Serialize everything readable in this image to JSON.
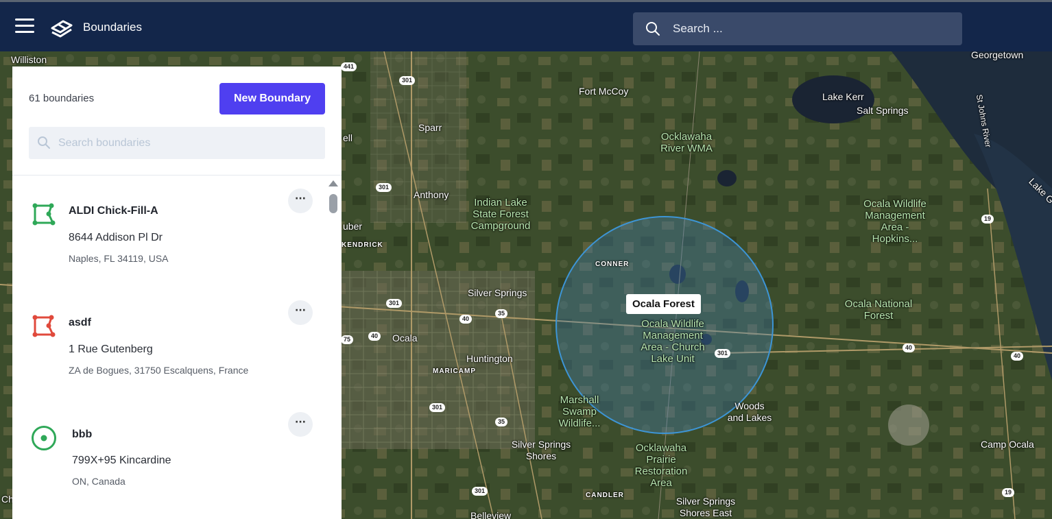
{
  "header": {
    "app_title": "Boundaries",
    "search_placeholder": "Search ..."
  },
  "panel": {
    "count_label": "61 boundaries",
    "new_button_label": "New Boundary",
    "search_placeholder": "Search boundaries",
    "items": [
      {
        "name": "ALDI Chick-Fill-A",
        "address_line1": "8644 Addison Pl Dr",
        "address_line2": "Naples, FL 34119, USA",
        "shape": "polygon",
        "color": "#2fa858",
        "more_label": "···"
      },
      {
        "name": "asdf",
        "address_line1": "1 Rue Gutenberg",
        "address_line2": "ZA de Bogues, 31750 Escalquens, France",
        "shape": "polygon",
        "color": "#e04a3c",
        "more_label": "···"
      },
      {
        "name": "bbb",
        "address_line1": "799X+95 Kincardine",
        "address_line2": "ON, Canada",
        "shape": "circle",
        "color": "#2fa858",
        "more_label": "···"
      }
    ]
  },
  "map": {
    "selected_boundary_label": "Ocala Forest",
    "place_labels": [
      "Williston",
      "Georgetown",
      "Fort McCoy",
      "Lake Kerr",
      "Salt Springs",
      "Sparr",
      "Ocklawaha River WMA",
      "St Johns River",
      "Lake G",
      "Anthony",
      "Indian Lake State Forest Campground",
      "Ocala Wildlife Management Area - Hopkins...",
      "CONNER",
      "uber",
      "KENDRICK",
      "ell",
      "Silver Springs",
      "Ocala Wildlife Management Area - Church Lake Unit",
      "Ocala National Forest",
      "Ocala",
      "Huntington",
      "MARICAMP",
      "Marshall Swamp Wildlife...",
      "Woods and Lakes",
      "Silver Springs Shores",
      "Camp Ocala",
      "Ocklawaha Prairie Restoration Area",
      "CANDLER",
      "Silver Springs Shores East",
      "Belleview",
      "Ch"
    ],
    "road_shields": [
      "441",
      "301",
      "301",
      "301",
      "301",
      "40",
      "35",
      "40",
      "75",
      "301",
      "35",
      "301",
      "40",
      "40",
      "19",
      "19"
    ]
  },
  "colors": {
    "header_bg": "#13264a",
    "primary_button": "#4f3ff0",
    "boundary_stroke": "#3d95d6"
  }
}
